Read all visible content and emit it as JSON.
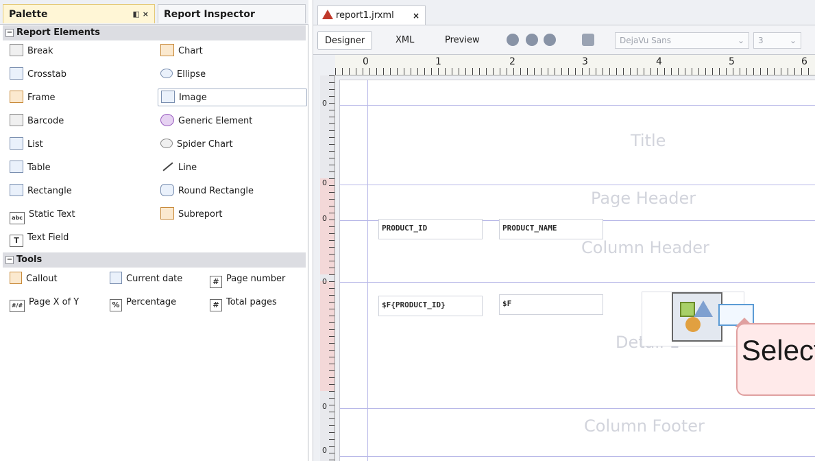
{
  "panel": {
    "palette_tab": "Palette",
    "palette_ctrls": "◧ ×",
    "inspector_tab": "Report Inspector"
  },
  "report_elements": {
    "header": "Report Elements",
    "items": [
      {
        "label": "Break",
        "icon": "break-icon"
      },
      {
        "label": "Chart",
        "icon": "chart-icon"
      },
      {
        "label": "Crosstab",
        "icon": "crosstab-icon"
      },
      {
        "label": "Ellipse",
        "icon": "ellipse-icon"
      },
      {
        "label": "Frame",
        "icon": "frame-icon"
      },
      {
        "label": "Image",
        "icon": "image-icon"
      },
      {
        "label": "Barcode",
        "icon": "barcode-icon"
      },
      {
        "label": "Generic Element",
        "icon": "generic-element-icon"
      },
      {
        "label": "List",
        "icon": "list-icon"
      },
      {
        "label": "Spider Chart",
        "icon": "spider-chart-icon"
      },
      {
        "label": "Table",
        "icon": "table-icon"
      },
      {
        "label": "Line",
        "icon": "line-icon"
      },
      {
        "label": "Rectangle",
        "icon": "rectangle-icon"
      },
      {
        "label": "Round Rectangle",
        "icon": "round-rectangle-icon"
      },
      {
        "label": "Static Text",
        "icon": "static-text-icon"
      },
      {
        "label": "Subreport",
        "icon": "subreport-icon"
      },
      {
        "label": "Text Field",
        "icon": "text-field-icon"
      }
    ]
  },
  "tools": {
    "header": "Tools",
    "items": [
      {
        "label": "Callout"
      },
      {
        "label": "Current date"
      },
      {
        "label": "Page number"
      },
      {
        "label": "Page X of Y"
      },
      {
        "label": "Percentage"
      },
      {
        "label": "Total pages"
      }
    ]
  },
  "editor": {
    "file_tab": "report1.jrxml",
    "file_close": "×",
    "views": [
      "Designer",
      "XML",
      "Preview"
    ],
    "active_view": "Designer",
    "font_name": "DejaVu Sans",
    "font_size": "3",
    "ruler_numbers": [
      "0",
      "1",
      "2",
      "3",
      "4",
      "5",
      "6"
    ],
    "vruler_zero": "0"
  },
  "canvas": {
    "bands": [
      "Title",
      "Page Header",
      "Column Header",
      "Detail 1",
      "Column Footer"
    ],
    "header_fields": [
      "PRODUCT_ID",
      "PRODUCT_NAME"
    ],
    "detail_fields": [
      "$F{PRODUCT_ID}",
      "$F"
    ],
    "callout_text": "Select"
  },
  "colors": {
    "accent_tab": "#fff6d6",
    "guide": "#b8b8e8",
    "callout_bg": "#ffeaea",
    "callout_border": "#e0a0a0"
  }
}
